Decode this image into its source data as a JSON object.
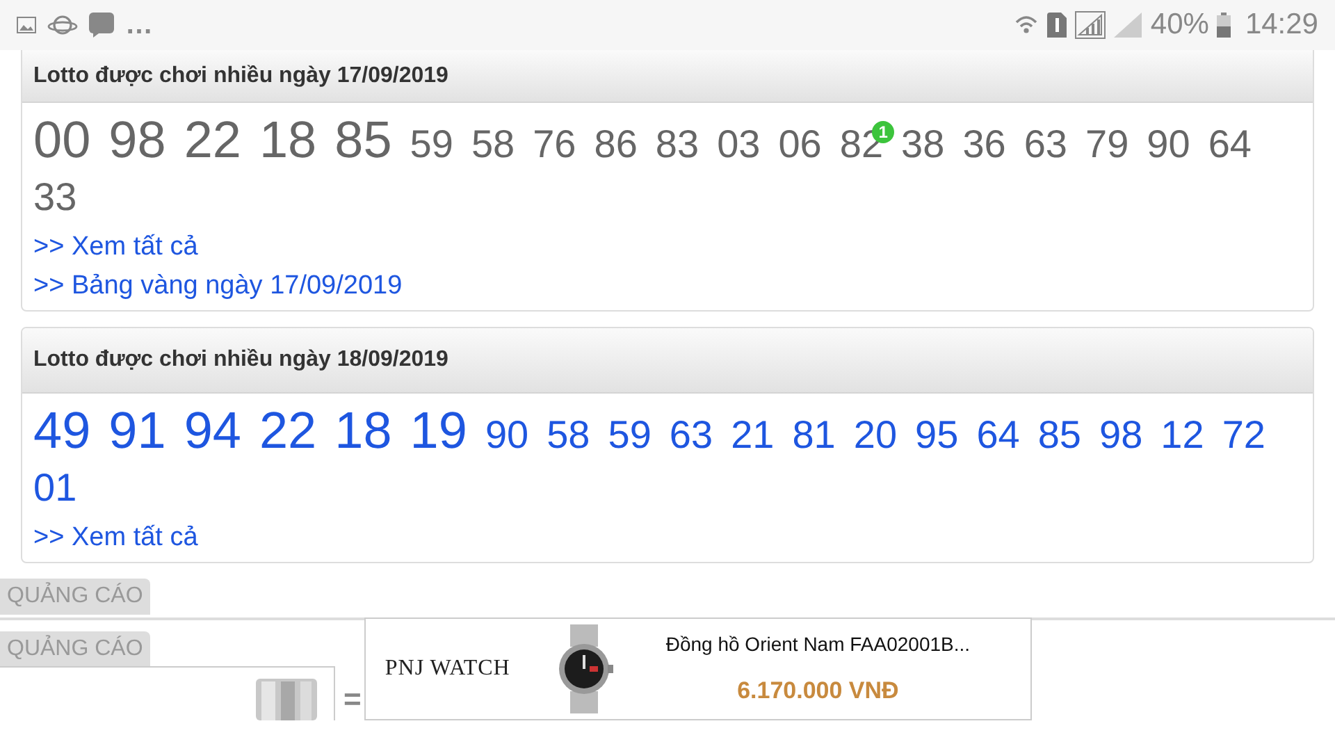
{
  "status_bar": {
    "notifications": [
      "…"
    ],
    "battery": "40%",
    "time": "14:29"
  },
  "cards": [
    {
      "title": "Lotto được chơi nhiều ngày 17/09/2019",
      "color": "#666666",
      "numbers": [
        {
          "value": "00",
          "kind": "hot"
        },
        {
          "value": "98",
          "kind": "hot"
        },
        {
          "value": "22",
          "kind": "hot"
        },
        {
          "value": "18",
          "kind": "hot"
        },
        {
          "value": "85",
          "kind": "hot"
        },
        {
          "value": "59",
          "kind": "normal"
        },
        {
          "value": "58",
          "kind": "normal"
        },
        {
          "value": "76",
          "kind": "normal"
        },
        {
          "value": "86",
          "kind": "normal"
        },
        {
          "value": "83",
          "kind": "normal"
        },
        {
          "value": "03",
          "kind": "normal"
        },
        {
          "value": "06",
          "kind": "normal"
        },
        {
          "value": "82",
          "kind": "normal",
          "badge": "1"
        },
        {
          "value": "38",
          "kind": "normal"
        },
        {
          "value": "36",
          "kind": "normal"
        },
        {
          "value": "63",
          "kind": "normal"
        },
        {
          "value": "79",
          "kind": "normal"
        },
        {
          "value": "90",
          "kind": "normal"
        },
        {
          "value": "64",
          "kind": "normal"
        },
        {
          "value": "33",
          "kind": "normal"
        }
      ],
      "links": [
        ">> Xem tất cả",
        ">> Bảng vàng ngày 17/09/2019"
      ]
    },
    {
      "title": "Lotto được chơi nhiều ngày 18/09/2019",
      "color": "#1e56e0",
      "numbers": [
        {
          "value": "49",
          "kind": "hot"
        },
        {
          "value": "91",
          "kind": "hot"
        },
        {
          "value": "94",
          "kind": "hot"
        },
        {
          "value": "22",
          "kind": "hot"
        },
        {
          "value": "18",
          "kind": "hot"
        },
        {
          "value": "19",
          "kind": "hot"
        },
        {
          "value": "90",
          "kind": "normal"
        },
        {
          "value": "58",
          "kind": "normal"
        },
        {
          "value": "59",
          "kind": "normal"
        },
        {
          "value": "63",
          "kind": "normal"
        },
        {
          "value": "21",
          "kind": "normal"
        },
        {
          "value": "81",
          "kind": "normal"
        },
        {
          "value": "20",
          "kind": "normal"
        },
        {
          "value": "95",
          "kind": "normal"
        },
        {
          "value": "64",
          "kind": "normal"
        },
        {
          "value": "85",
          "kind": "normal"
        },
        {
          "value": "98",
          "kind": "normal"
        },
        {
          "value": "12",
          "kind": "normal"
        },
        {
          "value": "72",
          "kind": "normal"
        },
        {
          "value": "01",
          "kind": "normal"
        }
      ],
      "links": [
        ">> Xem tất cả"
      ]
    }
  ],
  "ad_labels": [
    "QUẢNG CÁO",
    "QUẢNG CÁO"
  ],
  "ad": {
    "side_mark": "=",
    "brand": "PNJ WATCH",
    "product": "Đồng hồ Orient Nam FAA02001B...",
    "price": "6.170.000 VNĐ"
  }
}
